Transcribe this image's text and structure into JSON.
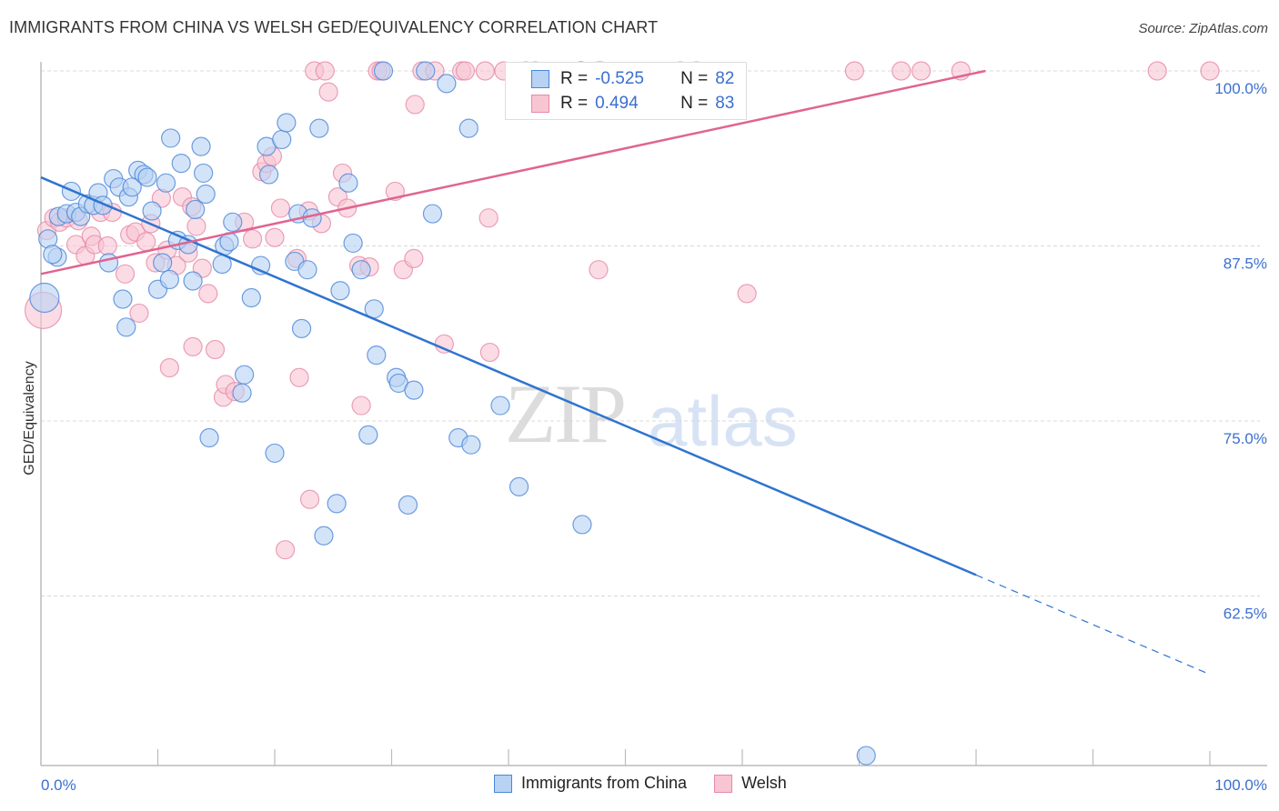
{
  "header": {
    "title": "IMMIGRANTS FROM CHINA VS WELSH GED/EQUIVALENCY CORRELATION CHART",
    "source": "Source: ZipAtlas.com"
  },
  "watermark": {
    "zip": "ZIP",
    "atlas": "atlas"
  },
  "legend": {
    "series": [
      {
        "r_label": "R =",
        "r_value": "-0.525",
        "n_label": "N =",
        "n_value": "82"
      },
      {
        "r_label": "R =",
        "r_value": "0.494",
        "n_label": "N =",
        "n_value": "83"
      }
    ]
  },
  "bottom_legend": [
    "Immigrants from China",
    "Welsh"
  ],
  "colors": {
    "blue_fill": "#b7d2f3",
    "blue_stroke": "#4a86d8",
    "blue_line": "#2f74d0",
    "pink_fill": "#f8c5d3",
    "pink_stroke": "#e58aa7",
    "pink_line": "#e06490",
    "tick_text": "#3b6fd0"
  },
  "chart_data": {
    "type": "scatter",
    "title": "IMMIGRANTS FROM CHINA VS WELSH GED/EQUIVALENCY CORRELATION CHART",
    "xlabel": "",
    "ylabel": "GED/Equivalency",
    "xlim": [
      0,
      100
    ],
    "ylim": [
      50.4,
      101
    ],
    "x_tick_labels": [
      "0.0%",
      "100.0%"
    ],
    "y_ticks": [
      100,
      87.5,
      75,
      62.5
    ],
    "y_tick_labels": [
      "100.0%",
      "87.5%",
      "75.0%",
      "62.5%"
    ],
    "grid": true,
    "legend_position": "top-center",
    "series": [
      {
        "name": "Immigrants from China",
        "r": -0.525,
        "n": 82,
        "trend": {
          "x0": 0,
          "y0": 92.4,
          "x1": 80,
          "y1": 64.0,
          "x_end_dashed": 100,
          "y_end_dashed": 56.9
        },
        "points": [
          [
            0.3,
            83.8
          ],
          [
            0.6,
            88.0
          ],
          [
            1.4,
            86.7
          ],
          [
            1.5,
            89.6
          ],
          [
            2.2,
            89.8
          ],
          [
            2.6,
            91.4
          ],
          [
            3.0,
            89.9
          ],
          [
            3.4,
            89.6
          ],
          [
            4.0,
            90.5
          ],
          [
            4.5,
            90.4
          ],
          [
            4.9,
            91.3
          ],
          [
            5.3,
            90.4
          ],
          [
            5.8,
            86.3
          ],
          [
            6.2,
            92.3
          ],
          [
            6.7,
            91.7
          ],
          [
            7.0,
            83.7
          ],
          [
            7.3,
            81.7
          ],
          [
            7.5,
            91.0
          ],
          [
            7.8,
            91.7
          ],
          [
            8.3,
            92.9
          ],
          [
            8.8,
            92.6
          ],
          [
            9.1,
            92.4
          ],
          [
            9.5,
            90.0
          ],
          [
            10.0,
            84.4
          ],
          [
            10.4,
            86.3
          ],
          [
            10.7,
            92.0
          ],
          [
            11.0,
            85.1
          ],
          [
            11.1,
            95.2
          ],
          [
            11.7,
            87.9
          ],
          [
            12.0,
            93.4
          ],
          [
            12.6,
            87.6
          ],
          [
            13.0,
            85.0
          ],
          [
            13.2,
            90.1
          ],
          [
            13.7,
            94.6
          ],
          [
            13.9,
            92.7
          ],
          [
            14.1,
            91.2
          ],
          [
            14.4,
            73.8
          ],
          [
            15.5,
            86.2
          ],
          [
            15.7,
            87.5
          ],
          [
            16.1,
            87.8
          ],
          [
            16.4,
            89.2
          ],
          [
            17.2,
            77.0
          ],
          [
            17.4,
            78.3
          ],
          [
            18.0,
            83.8
          ],
          [
            18.8,
            86.1
          ],
          [
            19.3,
            94.6
          ],
          [
            19.5,
            92.6
          ],
          [
            20.0,
            72.7
          ],
          [
            20.6,
            95.1
          ],
          [
            21.0,
            96.3
          ],
          [
            21.7,
            86.4
          ],
          [
            22.0,
            89.8
          ],
          [
            22.3,
            81.6
          ],
          [
            22.8,
            85.8
          ],
          [
            23.2,
            89.5
          ],
          [
            23.8,
            95.9
          ],
          [
            24.2,
            66.8
          ],
          [
            25.3,
            69.1
          ],
          [
            25.6,
            84.3
          ],
          [
            26.3,
            92.0
          ],
          [
            26.7,
            87.7
          ],
          [
            27.4,
            85.8
          ],
          [
            28.0,
            74.0
          ],
          [
            28.5,
            83.0
          ],
          [
            28.7,
            79.7
          ],
          [
            29.3,
            100.0
          ],
          [
            30.4,
            78.1
          ],
          [
            30.6,
            77.7
          ],
          [
            31.4,
            69.0
          ],
          [
            31.9,
            77.2
          ],
          [
            32.9,
            100.0
          ],
          [
            33.5,
            89.8
          ],
          [
            34.7,
            99.1
          ],
          [
            35.7,
            73.8
          ],
          [
            36.6,
            95.9
          ],
          [
            36.8,
            73.3
          ],
          [
            39.3,
            76.1
          ],
          [
            40.9,
            70.3
          ],
          [
            46.3,
            67.6
          ],
          [
            70.6,
            51.1
          ],
          [
            46.2,
            100.0
          ],
          [
            1.0,
            86.9
          ]
        ]
      },
      {
        "name": "Welsh",
        "r": 0.494,
        "n": 83,
        "trend": {
          "x0": 0,
          "y0": 85.5,
          "x1": 80.8,
          "y1": 100.0
        },
        "points": [
          [
            0.2,
            82.9
          ],
          [
            0.5,
            88.6
          ],
          [
            1.1,
            89.5
          ],
          [
            1.6,
            89.2
          ],
          [
            2.2,
            89.5
          ],
          [
            3.0,
            87.6
          ],
          [
            3.2,
            89.3
          ],
          [
            3.8,
            86.8
          ],
          [
            4.3,
            88.2
          ],
          [
            4.6,
            87.6
          ],
          [
            5.1,
            89.9
          ],
          [
            5.7,
            87.5
          ],
          [
            6.1,
            89.9
          ],
          [
            7.2,
            85.5
          ],
          [
            7.6,
            88.3
          ],
          [
            8.1,
            88.5
          ],
          [
            8.4,
            82.7
          ],
          [
            9.0,
            87.8
          ],
          [
            9.4,
            89.1
          ],
          [
            9.8,
            86.3
          ],
          [
            10.3,
            90.9
          ],
          [
            10.8,
            87.2
          ],
          [
            11.0,
            78.8
          ],
          [
            11.6,
            86.1
          ],
          [
            12.1,
            91.0
          ],
          [
            12.6,
            87.0
          ],
          [
            12.9,
            90.3
          ],
          [
            13.0,
            80.3
          ],
          [
            13.3,
            88.9
          ],
          [
            13.8,
            85.9
          ],
          [
            14.3,
            84.1
          ],
          [
            14.9,
            80.1
          ],
          [
            15.6,
            76.7
          ],
          [
            15.8,
            77.6
          ],
          [
            16.6,
            77.1
          ],
          [
            17.4,
            89.2
          ],
          [
            18.1,
            88.0
          ],
          [
            18.9,
            92.8
          ],
          [
            19.3,
            93.4
          ],
          [
            19.8,
            93.9
          ],
          [
            20.0,
            88.1
          ],
          [
            20.5,
            90.2
          ],
          [
            20.9,
            65.8
          ],
          [
            21.9,
            86.6
          ],
          [
            22.1,
            78.1
          ],
          [
            22.9,
            90.0
          ],
          [
            23.0,
            69.4
          ],
          [
            23.4,
            100.0
          ],
          [
            24.3,
            100.0
          ],
          [
            24.6,
            98.5
          ],
          [
            24.0,
            89.1
          ],
          [
            25.4,
            91.0
          ],
          [
            25.8,
            92.7
          ],
          [
            26.2,
            90.2
          ],
          [
            27.2,
            86.1
          ],
          [
            27.4,
            76.1
          ],
          [
            28.1,
            86.0
          ],
          [
            28.8,
            100.0
          ],
          [
            29.1,
            100.0
          ],
          [
            30.3,
            91.4
          ],
          [
            31.0,
            85.8
          ],
          [
            31.9,
            86.6
          ],
          [
            32.0,
            97.6
          ],
          [
            32.6,
            100.0
          ],
          [
            33.7,
            100.0
          ],
          [
            34.5,
            80.5
          ],
          [
            36.0,
            100.0
          ],
          [
            36.3,
            100.0
          ],
          [
            38.0,
            100.0
          ],
          [
            38.3,
            89.5
          ],
          [
            38.4,
            79.9
          ],
          [
            39.6,
            100.0
          ],
          [
            41.5,
            100.0
          ],
          [
            42.3,
            100.0
          ],
          [
            47.7,
            100.0
          ],
          [
            47.9,
            100.0
          ],
          [
            47.7,
            85.8
          ],
          [
            54.7,
            100.0
          ],
          [
            56.1,
            100.0
          ],
          [
            60.4,
            84.1
          ],
          [
            69.6,
            100.0
          ],
          [
            73.6,
            100.0
          ],
          [
            75.3,
            100.0
          ],
          [
            78.7,
            100.0
          ],
          [
            95.5,
            100.0
          ],
          [
            100.0,
            100.0
          ]
        ]
      }
    ]
  }
}
